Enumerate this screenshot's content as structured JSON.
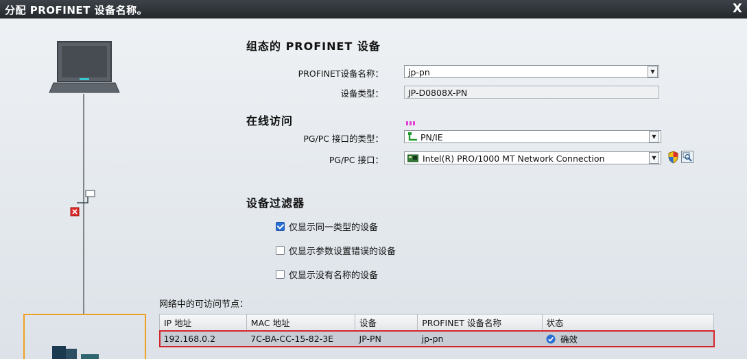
{
  "window": {
    "title": "分配 PROFINET 设备名称。",
    "close_label": "X"
  },
  "configured_device": {
    "heading": "组态的 PROFINET 设备",
    "name_label": "PROFINET设备名称：",
    "name_value": "jp-pn",
    "type_label": "设备类型：",
    "type_value": "JP-D0808X-PN"
  },
  "online_access": {
    "heading": "在线访问",
    "interface_type_label": "PG/PC 接口的类型：",
    "interface_type_value": "PN/IE",
    "interface_label": "PG/PC 接口：",
    "interface_value": "Intel(R) PRO/1000 MT Network Connection"
  },
  "device_filter": {
    "heading": "设备过滤器",
    "options": [
      {
        "label": "仅显示同一类型的设备",
        "checked": true
      },
      {
        "label": "仅显示参数设置错误的设备",
        "checked": false
      },
      {
        "label": "仅显示没有名称的设备",
        "checked": false
      }
    ]
  },
  "nodes": {
    "heading": "网络中的可访问节点：",
    "columns": [
      "IP 地址",
      "MAC 地址",
      "设备",
      "PROFINET 设备名称",
      "状态"
    ],
    "rows": [
      {
        "ip": "192.168.0.2",
        "mac": "7C-BA-CC-15-82-3E",
        "device": "JP-PN",
        "name": "jp-pn",
        "status": "确效"
      }
    ]
  },
  "colors": {
    "titlebar": "#23282d",
    "selection_border": "#d4242a",
    "accent": "#2a6ed1",
    "diagram_frame": "#f0a01e"
  }
}
